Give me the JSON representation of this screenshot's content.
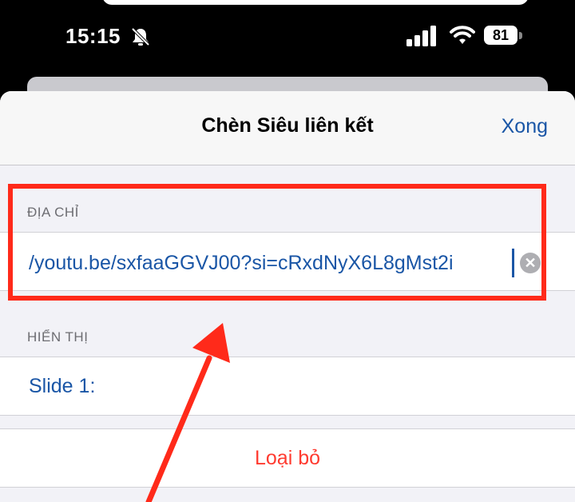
{
  "status_bar": {
    "time": "15:15",
    "battery": "81",
    "icons": [
      "bell-slash-icon",
      "signal-icon",
      "wifi-icon",
      "battery-icon"
    ]
  },
  "sheet": {
    "title": "Chèn Siêu liên kết",
    "done_label": "Xong"
  },
  "address": {
    "header": "ĐỊA CHỈ",
    "value": "/youtu.be/sxfaaGGVJ00?si=cRxdNyX6L8gMst2i"
  },
  "display": {
    "header": "HIỂN THỊ",
    "value": "Slide 1:"
  },
  "remove_label": "Loại bỏ",
  "colors": {
    "accent": "#1a56a6",
    "destructive": "#ff3b30",
    "annotation": "#ff2a1a"
  }
}
